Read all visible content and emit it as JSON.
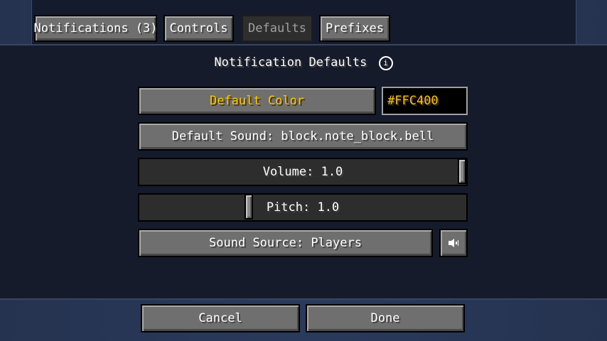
{
  "tabs": [
    {
      "label": "Notifications (3)",
      "active": false
    },
    {
      "label": "Controls",
      "active": false
    },
    {
      "label": "Defaults",
      "active": true
    },
    {
      "label": "Prefixes",
      "active": false
    }
  ],
  "section": {
    "title": "Notification Defaults",
    "info_icon": "i"
  },
  "default_color": {
    "label": "Default Color",
    "value": "#FFC400",
    "color": "#FFC400"
  },
  "default_sound": {
    "label": "Default Sound: block.note_block.bell"
  },
  "volume": {
    "label": "Volume: 1.0",
    "value": 1.0
  },
  "pitch": {
    "label": "Pitch: 1.0",
    "value": 1.0
  },
  "sound_source": {
    "label": "Sound Source: Players",
    "speaker_icon": "speaker-icon"
  },
  "footer": {
    "cancel_label": "Cancel",
    "done_label": "Done"
  }
}
